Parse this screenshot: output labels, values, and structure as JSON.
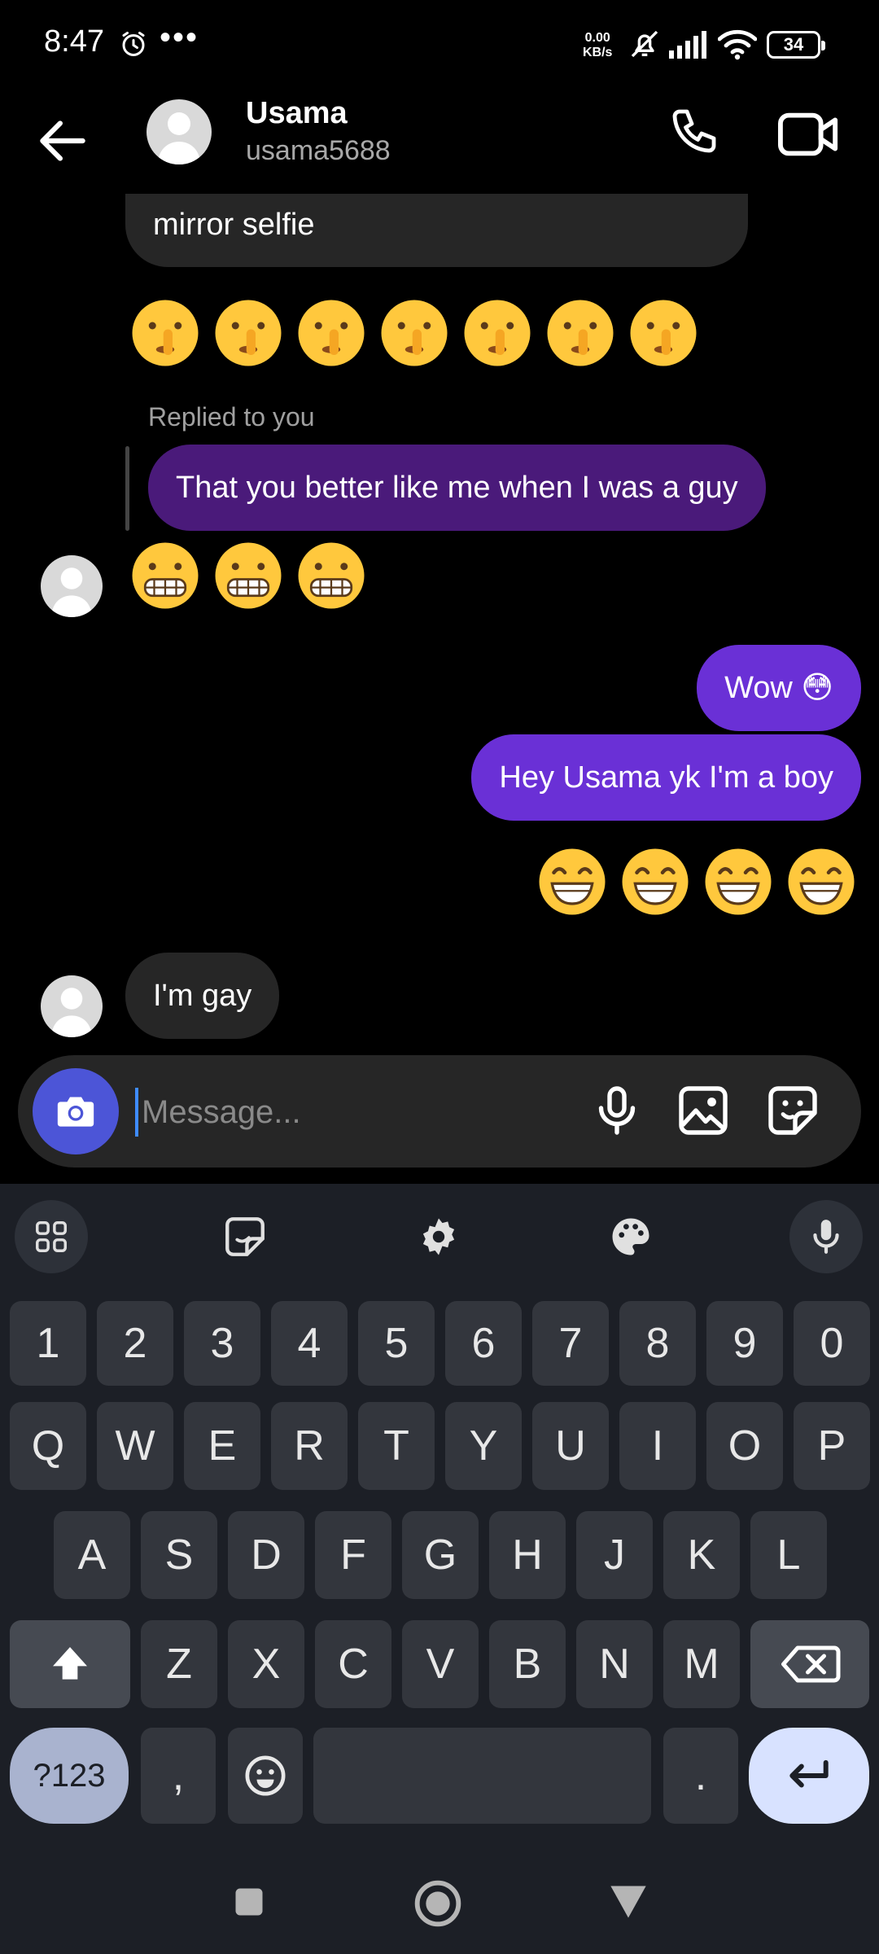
{
  "status_bar": {
    "time": "8:47",
    "dots": "•••",
    "net_speed_value": "0.00",
    "net_speed_unit": "KB/s",
    "battery": "34"
  },
  "header": {
    "name": "Usama",
    "username": "usama5688"
  },
  "messages": {
    "m1_text": "mirror selfie",
    "shush_emojis": [
      "🤫",
      "🤫",
      "🤫",
      "🤫",
      "🤫",
      "🤫",
      "🤫"
    ],
    "replied_label": "Replied to you",
    "reply_quote": "That you better like me when I was a guy",
    "grimace_emojis": [
      "😬",
      "😬",
      "😬"
    ],
    "sent_1": "Wow 😳",
    "sent_2": "Hey Usama yk I'm a boy",
    "grin_emojis": [
      "😁",
      "😁",
      "😁",
      "😁"
    ],
    "received_last": "I'm gay"
  },
  "composer": {
    "placeholder": "Message..."
  },
  "keyboard": {
    "numbers": [
      "1",
      "2",
      "3",
      "4",
      "5",
      "6",
      "7",
      "8",
      "9",
      "0"
    ],
    "row1": [
      "Q",
      "W",
      "E",
      "R",
      "T",
      "Y",
      "U",
      "I",
      "O",
      "P"
    ],
    "row2": [
      "A",
      "S",
      "D",
      "F",
      "G",
      "H",
      "J",
      "K",
      "L"
    ],
    "row3": [
      "Z",
      "X",
      "C",
      "V",
      "B",
      "N",
      "M"
    ],
    "symbols_key": "?123",
    "comma_key": ",",
    "period_key": "."
  },
  "colors": {
    "sent_bubble": "#6a30d6",
    "received_bubble": "#262626",
    "camera_button": "#4c55d7",
    "enter_key": "#d8e2ff",
    "symbols_key": "#a9b3cf"
  }
}
